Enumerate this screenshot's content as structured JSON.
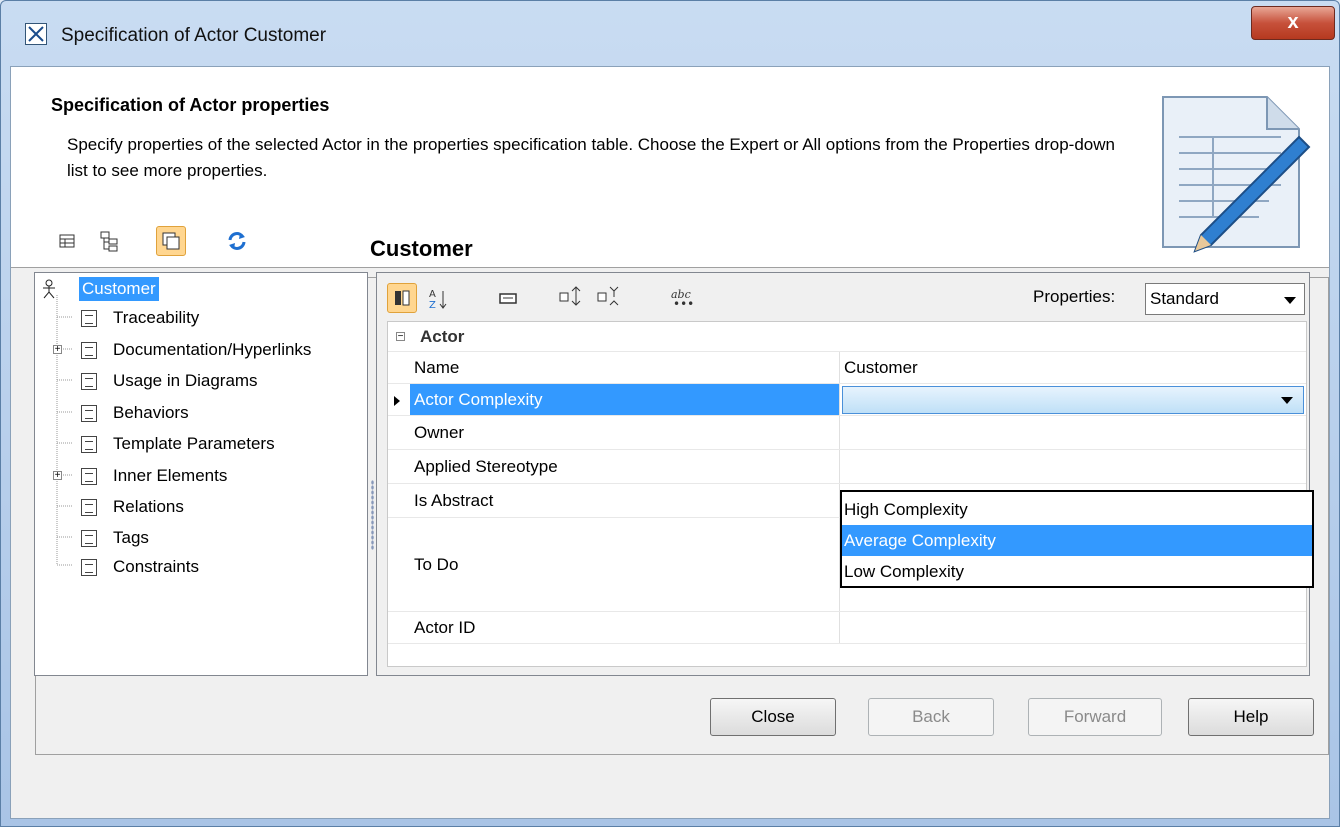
{
  "window": {
    "title": "Specification of Actor Customer",
    "close_glyph": "x"
  },
  "header": {
    "title": "Specification of Actor properties",
    "description": "Specify properties of the selected Actor in the properties specification table. Choose the Expert or All options from the Properties drop-down list to see more properties."
  },
  "left_toolbar": {
    "icons": [
      "table-view-icon",
      "tree-view-icon",
      "copy-icon",
      "refresh-icon"
    ]
  },
  "tree": {
    "root": "Customer",
    "items": [
      {
        "label": "Traceability",
        "expandable": false
      },
      {
        "label": "Documentation/Hyperlinks",
        "expandable": true
      },
      {
        "label": "Usage in Diagrams",
        "expandable": false
      },
      {
        "label": "Behaviors",
        "expandable": false
      },
      {
        "label": "Template Parameters",
        "expandable": false
      },
      {
        "label": "Inner Elements",
        "expandable": true
      },
      {
        "label": "Relations",
        "expandable": false
      },
      {
        "label": "Tags",
        "expandable": false
      },
      {
        "label": "Constraints",
        "expandable": false
      }
    ]
  },
  "properties_panel": {
    "element_title": "Customer",
    "properties_label": "Properties:",
    "properties_value": "Standard",
    "category": "Actor",
    "rows": [
      {
        "name": "Name",
        "value": "Customer"
      },
      {
        "name": "Actor Complexity",
        "value": ""
      },
      {
        "name": "Owner",
        "value": ""
      },
      {
        "name": "Applied Stereotype",
        "value": ""
      },
      {
        "name": "Is Abstract",
        "value": ""
      },
      {
        "name": "To Do",
        "value": ""
      },
      {
        "name": "Actor ID",
        "value": ""
      }
    ]
  },
  "dropdown": {
    "options": [
      "High Complexity",
      "Average Complexity",
      "Low Complexity"
    ],
    "highlighted": "Average Complexity"
  },
  "buttons": {
    "close": "Close",
    "back": "Back",
    "forward": "Forward",
    "help": "Help"
  },
  "colors": {
    "selection": "#3399ff",
    "toggle_selected": "#ffd690"
  }
}
